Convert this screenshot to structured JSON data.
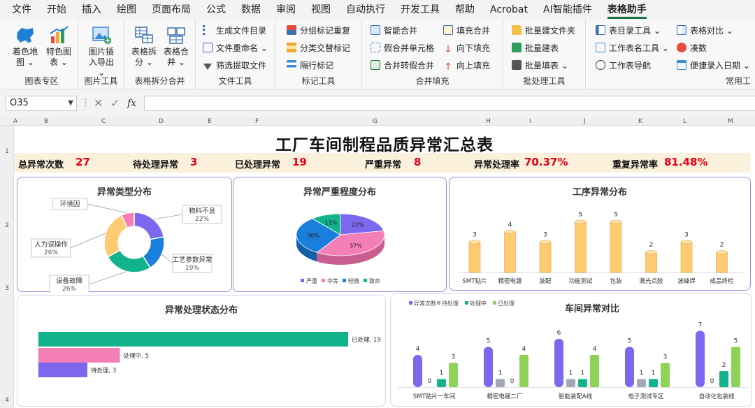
{
  "menu": [
    "文件",
    "开始",
    "插入",
    "绘图",
    "页面布局",
    "公式",
    "数据",
    "审阅",
    "视图",
    "自动执行",
    "开发工具",
    "帮助",
    "Acrobat",
    "AI智能插件",
    "表格助手"
  ],
  "active_menu": "表格助手",
  "ribbon": {
    "groups": [
      {
        "label": "图表专区",
        "buttons": [
          {
            "label": "着色地图",
            "caret": "⌄"
          },
          {
            "label": "特色图表",
            "caret": "⌄"
          }
        ]
      },
      {
        "label": "图片工具",
        "buttons": [
          {
            "label": "图片插入导出",
            "caret": "⌄"
          }
        ]
      },
      {
        "label": "表格拆分合并",
        "buttons": [
          {
            "label": "表格拆分",
            "caret": "⌄"
          },
          {
            "label": "表格合并",
            "caret": "⌄"
          }
        ]
      },
      {
        "label": "文件工具",
        "items": [
          "生成文件目录",
          "文件重命名 ⌄",
          "筛选提取文件"
        ]
      },
      {
        "label": "标记工具",
        "items": [
          "分组标记重复",
          "分类交替标记",
          "隔行标记"
        ]
      },
      {
        "label": "合并填充",
        "items": [
          "智能合并",
          "假合并单元格",
          "合并转假合并",
          "填充合并",
          "向下填充",
          "向上填充"
        ]
      },
      {
        "label": "批处理工具",
        "items": [
          "批量建文件夹",
          "批量建表",
          "批量填表 ⌄"
        ]
      },
      {
        "label": "常用工",
        "items": [
          "表目录工具 ⌄",
          "工作表名工具 ⌄",
          "工作表导航",
          "表格对比 ⌄",
          "凑数",
          "便捷录入日期 ⌄"
        ]
      }
    ]
  },
  "formula_bar": {
    "name_box": "O35",
    "fx": "fx",
    "value": ""
  },
  "columns": [
    "A",
    "B",
    "C",
    "D",
    "E",
    "F",
    "G",
    "H",
    "I",
    "J",
    "K",
    "L",
    "M"
  ],
  "rows": [
    "1",
    "2",
    "3",
    "4",
    "5"
  ],
  "sheet": {
    "title": "工厂车间制程品质异常汇总表",
    "stats": [
      {
        "label": "总异常次数",
        "value": "27"
      },
      {
        "label": "待处理异常",
        "value": "3"
      },
      {
        "label": "已处理异常",
        "value": "19"
      },
      {
        "label": "严重异常",
        "value": "8"
      },
      {
        "label": "异常处理率",
        "value": "70.37%"
      },
      {
        "label": "重复异常率",
        "value": "81.48%"
      }
    ]
  },
  "colors": {
    "purple": "#7b68ee",
    "blue": "#1a7fdc",
    "teal": "#12b38a",
    "orange": "#ffcb72",
    "pink": "#f47fb6",
    "gray": "#a0a8b8",
    "green": "#8fd25a",
    "red": "#e60012"
  },
  "chart_data": [
    {
      "type": "pie",
      "variant": "donut",
      "title": "异常类型分布",
      "slices": [
        {
          "label": "物料不良",
          "value": 22,
          "display": "22%"
        },
        {
          "label": "工艺参数异常",
          "value": 19,
          "display": "19%"
        },
        {
          "label": "设备故障",
          "value": 26,
          "display": "26%"
        },
        {
          "label": "人为误操作",
          "value": 26,
          "display": "26%"
        },
        {
          "label": "环境因",
          "value": 7,
          "display": ""
        }
      ]
    },
    {
      "type": "pie",
      "variant": "3d",
      "title": "异常严重程度分布",
      "slices": [
        {
          "label": "严重",
          "value": 22,
          "display": "22%"
        },
        {
          "label": "中等",
          "value": 37,
          "display": "37%"
        },
        {
          "label": "轻微",
          "value": 30,
          "display": "30%"
        },
        {
          "label": "致命",
          "value": 11,
          "display": "11%"
        }
      ],
      "legend": "bottom"
    },
    {
      "type": "bar",
      "title": "工序异常分布",
      "categories": [
        "SMT贴片",
        "精密电镀",
        "装配",
        "功能测试",
        "包装",
        "激光点胶",
        "波峰焊",
        "成品终检"
      ],
      "values": [
        3,
        4,
        3,
        5,
        5,
        2,
        3,
        2
      ]
    },
    {
      "type": "bar",
      "orientation": "horizontal",
      "title": "异常处理状态分布",
      "categories": [
        "已处理",
        "处理中",
        "待处理"
      ],
      "values": [
        19,
        5,
        3
      ]
    },
    {
      "type": "bar",
      "title": "车间异常对比",
      "categories": [
        "SMT贴片一车间",
        "精密电镀二厂",
        "智能装配A线",
        "电子测试专区",
        "自动化包装线"
      ],
      "series": [
        {
          "name": "异常次数",
          "values": [
            4,
            5,
            6,
            5,
            7
          ]
        },
        {
          "name": "待处理",
          "values": [
            0,
            1,
            1,
            1,
            0
          ]
        },
        {
          "name": "处理中",
          "values": [
            1,
            0,
            1,
            1,
            2
          ]
        },
        {
          "name": "已处理",
          "values": [
            3,
            4,
            4,
            3,
            5
          ]
        }
      ],
      "legend": "top-left"
    }
  ]
}
